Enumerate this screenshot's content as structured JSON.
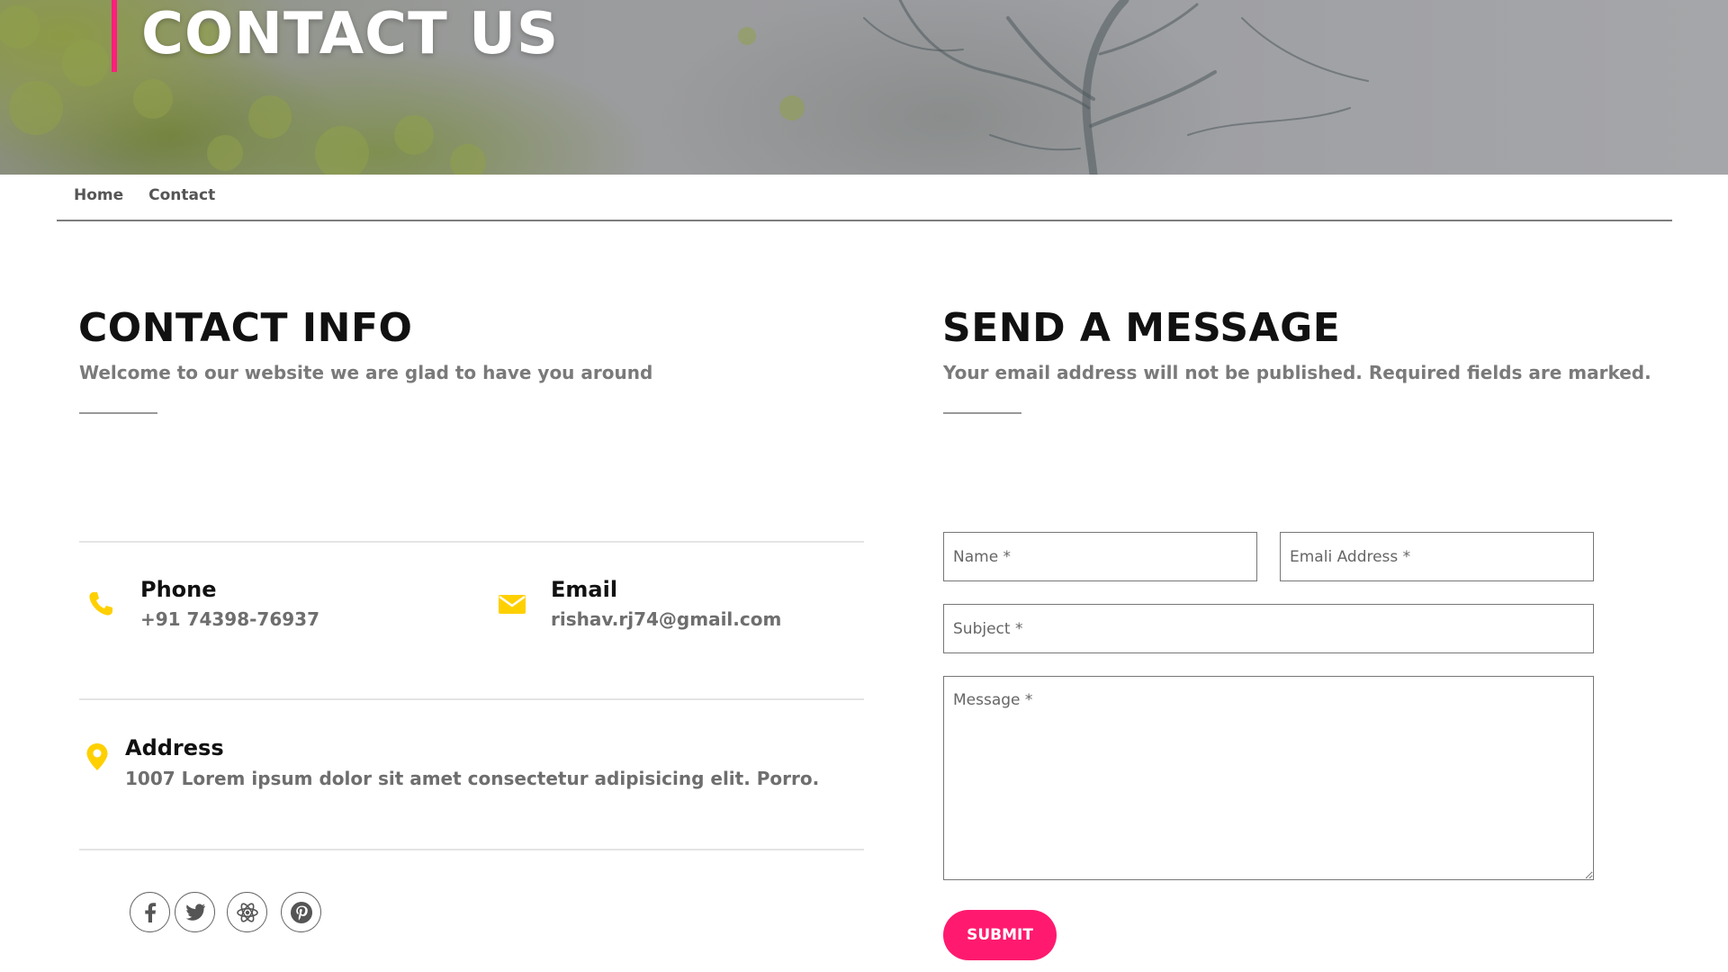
{
  "hero": {
    "title": "CONTACT US"
  },
  "breadcrumb": {
    "items": [
      {
        "label": "Home"
      },
      {
        "label": "Contact"
      }
    ]
  },
  "contact_info": {
    "title": "CONTACT INFO",
    "subtitle": "Welcome to our website we are glad to have you around",
    "phone": {
      "label": "Phone",
      "value": "+91 74398-76937",
      "icon": "phone-icon"
    },
    "email": {
      "label": "Email",
      "value": "rishav.rj74@gmail.com",
      "icon": "envelope-icon"
    },
    "address": {
      "label": "Address",
      "value": "1007 Lorem ipsum dolor sit amet consectetur adipisicing elit. Porro.",
      "icon": "map-pin-icon"
    },
    "social": [
      {
        "name": "facebook-icon"
      },
      {
        "name": "twitter-icon"
      },
      {
        "name": "react-icon"
      },
      {
        "name": "pinterest-icon"
      }
    ]
  },
  "message": {
    "title": "SEND A MESSAGE",
    "subtitle": "Your email address will not be published. Required fields are marked.",
    "name_placeholder": "Name *",
    "email_placeholder": "Emali Address *",
    "subject_placeholder": "Subject *",
    "message_placeholder": "Message *",
    "submit_label": "SUBMIT"
  },
  "colors": {
    "accent": "#ff1a6f",
    "icon": "#ffd000",
    "hero_bar": "#ff1f7c"
  }
}
